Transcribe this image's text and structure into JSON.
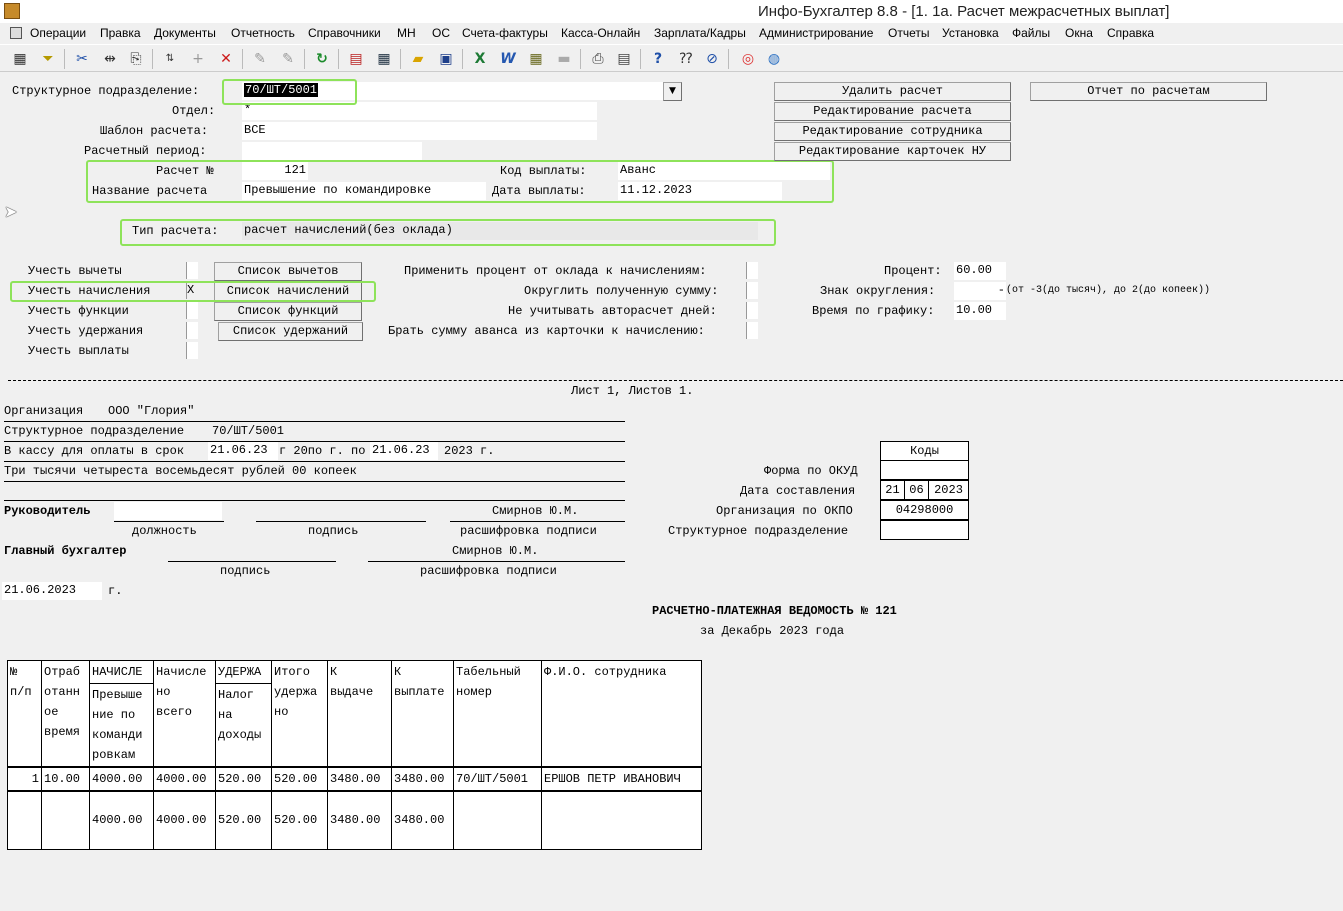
{
  "window": {
    "title": "Инфо-Бухгалтер 8.8 - [1. 1а. Расчет межрасчетных выплат]"
  },
  "menu": [
    "Операции",
    "Правка",
    "Документы",
    "Отчетность",
    "Справочники",
    "МН",
    "ОС",
    "Счета-фактуры",
    "Касса-Онлайн",
    "Зарплата/Кадры",
    "Администрирование",
    "Отчеты",
    "Установка",
    "Файлы",
    "Окна",
    "Справка"
  ],
  "form": {
    "struct_label": "Структурное подразделение:",
    "struct_value": "70/ШТ/5001",
    "dept_label": "Отдел:",
    "dept_value": "*",
    "template_label": "Шаблон расчета:",
    "template_value": "ВСЕ",
    "period_label": "Расчетный период:",
    "period_value": "",
    "calc_no_label": "Расчет №",
    "calc_no_value": "121",
    "calc_name_label": "Название расчета",
    "calc_name_value": "Превышение по командировке",
    "pay_code_label": "Код выплаты:",
    "pay_code_value": "Аванс",
    "pay_date_label": "Дата выплаты:",
    "pay_date_value": "11.12.2023",
    "type_label": "Тип расчета:",
    "type_value": "расчет начислений(без оклада)"
  },
  "buttons": {
    "delete": "Удалить расчет",
    "report": "Отчет по расчетам",
    "edit_calc": "Редактирование расчета",
    "edit_emp": "Редактирование сотрудника",
    "edit_cards": "Редактирование карточек НУ"
  },
  "options": {
    "deductions_label": "Учесть вычеты",
    "deductions_checked": "",
    "deductions_btn": "Список вычетов",
    "accruals_label": "Учесть начисления",
    "accruals_checked": "X",
    "accruals_btn": "Список начислений",
    "functions_label": "Учесть функции",
    "functions_checked": "",
    "functions_btn": "Список функций",
    "withholdings_label": "Учесть удержания",
    "withholdings_checked": "",
    "withholdings_btn": "Список удержаний",
    "payments_label": "Учесть выплаты",
    "payments_checked": ""
  },
  "right_options": {
    "apply_percent_label": "Применить процент от оклада к начислениям:",
    "round_label": "Округлить полученную сумму:",
    "no_auto_label": "Не учитывать авторасчет дней:",
    "take_advance_label": "Брать сумму аванса из карточки к начислению:",
    "percent_label": "Процент:",
    "percent_value": "60.00",
    "round_sign_label": "Знак округления:",
    "round_sign_value": "-",
    "round_hint": "(от -3(до тысяч), до 2(до копеек))",
    "schedule_label": "Время по графику:",
    "schedule_value": "10.00"
  },
  "doc": {
    "sheet": "Лист 1, Листов 1.",
    "org_label": "Организация",
    "org_value": "ООО \"Глория\"",
    "struct_label": "Структурное подразделение",
    "struct_value": "70/ШТ/5001",
    "cash_label": "В кассу для оплаты в срок",
    "cash_from": "21.06.23",
    "cash_mid": "г 20по г. по",
    "cash_to": "21.06.23",
    "cash_year": "2023 г.",
    "amount_words": "Три тысячи четыреста восемьдесят рублей 00 копеек",
    "codes_header": "Коды",
    "okud_label": "Форма по ОКУД",
    "okud_value": "",
    "date_label": "Дата составления",
    "date_d": "21",
    "date_m": "06",
    "date_y": "2023",
    "okpo_label": "Организация по ОКПО",
    "okpo_value": "04298000",
    "subdiv_label": "Структурное подразделение",
    "subdiv_value": "",
    "head_label": "Руководитель",
    "head_position": "",
    "head_name": "Смирнов Ю.М.",
    "position_caption": "должность",
    "signature_caption": "подпись",
    "decode_caption": "расшифровка подписи",
    "chief_label": "Главный бухгалтер",
    "chief_name": "Смирнов Ю.М.",
    "doc_date": "21.06.2023",
    "doc_date_suffix": "г.",
    "statement_title": "РАСЧЕТНО-ПЛАТЕЖНАЯ ВЕДОМОСТЬ № 121",
    "statement_period": "за Декабрь 2023 года"
  },
  "table": {
    "headers": [
      "№\nп/п",
      "Отраб\nотанн\nое\nвремя",
      "НАЧИСЛЕ",
      "Начисле\nно\nвсего",
      "УДЕРЖА",
      "Итого\nудержа\nно",
      "К\nвыдаче",
      "К\nвыплате",
      "Табельный\nномер",
      "Ф.И.О. сотрудника"
    ],
    "sub_accrual": "Превыше\nние по\nкоманди\nровкам",
    "sub_withhold": "Налог\nна\nдоходы",
    "row": [
      "1",
      "10.00",
      "4000.00",
      "4000.00",
      "520.00",
      "520.00",
      "3480.00",
      "3480.00",
      "70/ШТ/5001",
      "ЕРШОВ ПЕТР ИВАНОВИЧ"
    ],
    "totals": [
      "",
      "",
      "4000.00",
      "4000.00",
      "520.00",
      "520.00",
      "3480.00",
      "3480.00",
      "",
      ""
    ]
  }
}
